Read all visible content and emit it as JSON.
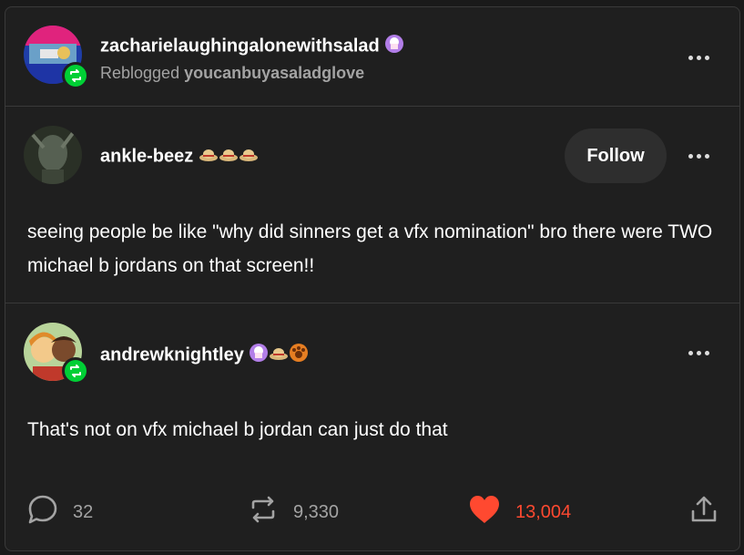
{
  "reblogger": {
    "username": "zacharielaughingalonewithsalad",
    "reblogged_prefix": "Reblogged",
    "reblogged_from": "youcanbuyasaladglove"
  },
  "original_post": {
    "username": "ankle-beez",
    "follow_label": "Follow",
    "text": "seeing people be like \"why did sinners get a vfx nomination\" bro there were TWO michael b jordans on that screen!!"
  },
  "reblog_comment": {
    "username": "andrewknightley",
    "text": "That's not on vfx michael b jordan can just do that"
  },
  "footer": {
    "comments": "32",
    "reblogs": "9,330",
    "likes": "13,004"
  },
  "colors": {
    "accent_green": "#00cf35",
    "like_red": "#ff4930",
    "card_bg": "#1f1f1f"
  },
  "icons": [
    "more-icon",
    "reblog-icon",
    "comment-icon",
    "heart-icon",
    "share-icon",
    "cupcake-badge-icon",
    "hat-badge-icon",
    "paw-badge-icon"
  ]
}
